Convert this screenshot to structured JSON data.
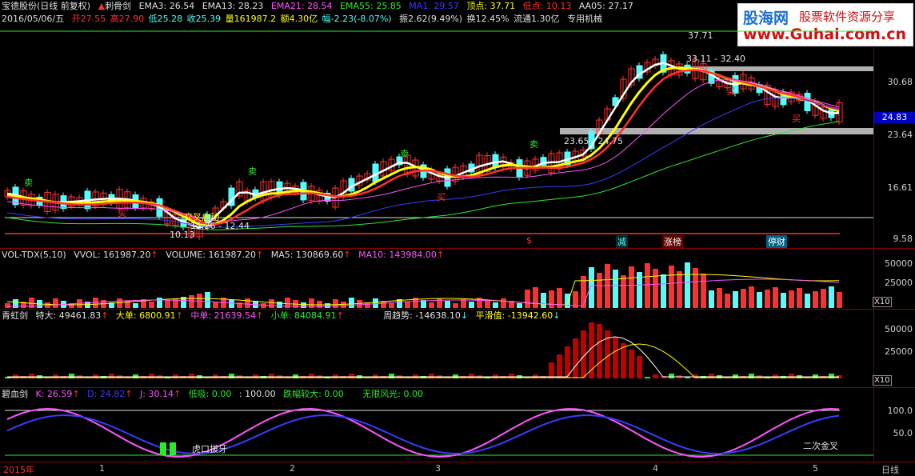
{
  "header": {
    "stock": "宝德股份(日线 前复权)",
    "indicator": "刺骨剑",
    "ema3": "EMA3: 26.54",
    "ema13": "EMA13: 28.23",
    "ema21": "EMA21: 28.54",
    "ema55": "EMA55: 25.85",
    "ma1": "MA1: 29.57",
    "top": "顶点: 37.71",
    "low": "低点: 10.13",
    "aa05": "AA05: 27.17"
  },
  "quote": {
    "date": "2016/05/06/五",
    "open": "开27.55",
    "high": "高27.90",
    "lowp": "低25.28",
    "close": "收25.39",
    "vol": "量161987.2",
    "amount": "额4.30亿",
    "change": "幅-2.23(-8.07%)",
    "swing": "振2.62(9.49%)",
    "turnover": "换12.45%",
    "float": "流通1.30亿",
    "sector": "专用机械"
  },
  "logo": {
    "name": "股海网",
    "slogan": "股票软件资源分享",
    "url": "www.Guhai.com.cn"
  },
  "price_axis": [
    "30.68",
    "23.64",
    "16.61",
    "9.58"
  ],
  "current_price": "24.83",
  "main_annotations": {
    "top_price": "37.71",
    "range1": "33.11 - 32.40",
    "range2": "23.65 - 24.75",
    "range3": "12.26 - 12.44",
    "low_price": "10.13",
    "buy": "买",
    "sell": "卖",
    "cross_label": "交叉启动",
    "events": [
      "减",
      "涨榜",
      "停财"
    ],
    "dollar": "$"
  },
  "vol_panel": {
    "label": "VOL-TDX(5,10)",
    "vvol": "VVOL: 161987.20",
    "volume": "VOLUME: 161987.20",
    "ma5": "MA5: 130869.60",
    "ma10": "MA10: 143984.00",
    "axis": [
      "50000",
      "25000"
    ],
    "unit": "X10"
  },
  "flow_panel": {
    "label": "青虹剑",
    "big": "特大: 49461.83",
    "large": "大单: 6800.91",
    "mid": "中单: 21639.54",
    "small": "小单: 84084.91",
    "trend": "周趋势: -14638.10",
    "smooth": "平滑值: -13942.60",
    "axis": [
      "50000",
      "25000"
    ],
    "unit": "X10"
  },
  "kdj_panel": {
    "label": "碧血剑",
    "k": "K: 26.59",
    "d": "D: 24.82",
    "j": "J: 30.14",
    "absorb": "低吸: 0.00",
    "hundred": ": 100.00",
    "drop": "跌幅较大: 0.00",
    "glory": "无限风光: 0.00",
    "axis": [
      "100.0",
      "50.0"
    ],
    "tiger": "虎口拔牙",
    "golden": "二次金叉"
  },
  "timeline": {
    "year": "2015年",
    "months": [
      "1",
      "2",
      "3",
      "4",
      "5"
    ],
    "period": "日线"
  },
  "colors": {
    "up": "#ff3030",
    "down": "#54fcfc",
    "ema3": "#ffffff",
    "ema13": "#ff3030",
    "ema21": "#ff55ff",
    "ema55": "#2ee82e",
    "ma1": "#3b3bff",
    "yellow": "#ffff00"
  }
}
